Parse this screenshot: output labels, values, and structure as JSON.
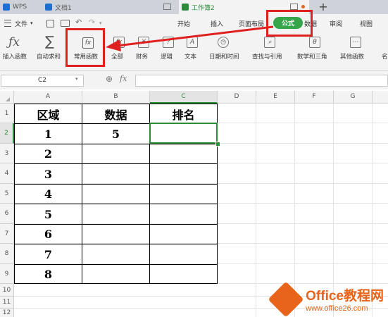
{
  "titlebar": {
    "tabs": [
      {
        "label": "WPS",
        "active": false,
        "color": "#1f6fd0"
      },
      {
        "label": "文档1",
        "active": false,
        "color": "#1f6fd0"
      },
      {
        "label": "工作簿2",
        "active": true,
        "color": "#2e8b3a"
      }
    ],
    "new_tab": "+"
  },
  "menu": {
    "file_label": "文件",
    "items": [
      "开始",
      "插入",
      "页面布局",
      "公式",
      "数据",
      "审阅",
      "视图"
    ],
    "active": "公式"
  },
  "ribbon": {
    "buttons": [
      {
        "label": "插入函数",
        "icon": "fx-icon"
      },
      {
        "label": "自动求和",
        "icon": "sigma-icon"
      },
      {
        "label": "常用函数",
        "icon": "common-functions-icon"
      },
      {
        "label": "全部",
        "icon": "all-functions-icon"
      },
      {
        "label": "财务",
        "icon": "finance-icon"
      },
      {
        "label": "逻辑",
        "icon": "logic-icon"
      },
      {
        "label": "文本",
        "icon": "text-icon"
      },
      {
        "label": "日期和时间",
        "icon": "datetime-icon"
      },
      {
        "label": "查找与引用",
        "icon": "lookup-icon"
      },
      {
        "label": "数学和三角",
        "icon": "math-icon"
      },
      {
        "label": "其他函数",
        "icon": "other-functions-icon"
      },
      {
        "label": "名",
        "icon": "name-icon"
      }
    ]
  },
  "formula_bar": {
    "name_box": "C2",
    "fx": "fx",
    "value": ""
  },
  "columns": [
    "A",
    "B",
    "C",
    "D",
    "E",
    "F",
    "G"
  ],
  "rows": [
    "1",
    "2",
    "3",
    "4",
    "5",
    "6",
    "7",
    "8",
    "9",
    "10",
    "11",
    "12"
  ],
  "table": {
    "headers": [
      "区域",
      "数据",
      "排名"
    ],
    "rows": [
      [
        "1",
        "5",
        ""
      ],
      [
        "2",
        "",
        ""
      ],
      [
        "3",
        "",
        ""
      ],
      [
        "4",
        "",
        ""
      ],
      [
        "5",
        "",
        ""
      ],
      [
        "6",
        "",
        ""
      ],
      [
        "7",
        "",
        ""
      ],
      [
        "8",
        "",
        ""
      ]
    ]
  },
  "selected_cell": "C2",
  "watermark": {
    "brand": "Office教程网",
    "url": "www.office26.com"
  },
  "colors": {
    "accent_green": "#35a64a",
    "annotation_red": "#e02020",
    "watermark_orange": "#e8641b"
  }
}
